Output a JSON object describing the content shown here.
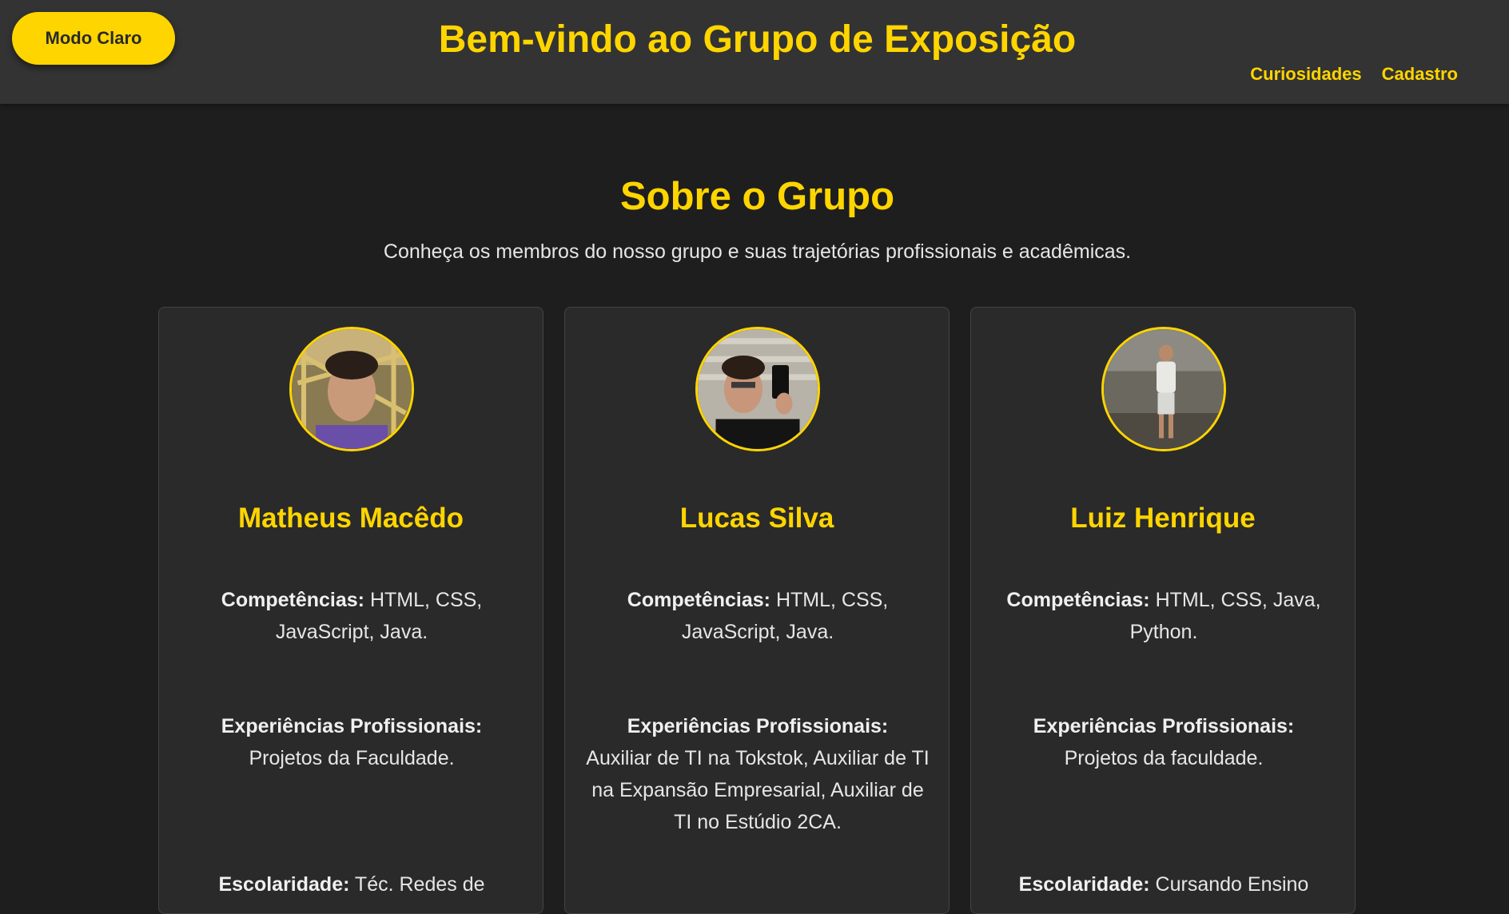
{
  "header": {
    "theme_button": "Modo Claro",
    "title": "Bem-vindo ao Grupo de Exposição",
    "nav": [
      "Curiosidades",
      "Cadastro"
    ]
  },
  "about": {
    "title": "Sobre o Grupo",
    "subtitle": "Conheça os membros do nosso grupo e suas trajetórias profissionais e acadêmicas."
  },
  "labels": {
    "competencias": "Competências:",
    "experiencias": "Experiências Profissionais:",
    "escolaridade": "Escolaridade:"
  },
  "members": [
    {
      "name": "Matheus Macêdo",
      "competencias": "HTML, CSS, JavaScript, Java.",
      "experiencias": "Projetos da Faculdade.",
      "escolaridade": "Téc. Redes de"
    },
    {
      "name": "Lucas Silva",
      "competencias": "HTML, CSS, JavaScript, Java.",
      "experiencias": "Auxiliar de TI na Tokstok, Auxiliar de TI na Expansão Empresarial, Auxiliar de TI no Estúdio 2CA.",
      "escolaridade": ""
    },
    {
      "name": "Luiz Henrique",
      "competencias": "HTML, CSS, Java, Python.",
      "experiencias": "Projetos da faculdade.",
      "escolaridade": "Cursando Ensino"
    }
  ],
  "colors": {
    "accent": "#ffd500",
    "header_bg": "#333333",
    "page_bg": "#1e1e1e",
    "card_bg": "#2a2a2a"
  }
}
